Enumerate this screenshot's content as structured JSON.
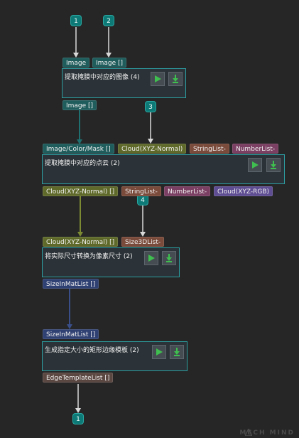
{
  "theme": {
    "accent": "#2c9fa2",
    "badge_color": "#0e7a77",
    "run_icon_color": "#3fbf4f",
    "image_port_color": "#1f5c5c",
    "cloud_port_color": "#5f6a2a",
    "string_list_port_color": "#7a4a3a",
    "number_list_port_color": "#7a3f62",
    "cloud_rgb_port_color": "#5e4d92",
    "size_list_port_color": "#2f4072"
  },
  "inputs": {
    "badge_1": "1",
    "badge_2": "2",
    "badge_3": "3",
    "badge_4": "4"
  },
  "step1": {
    "title": "提取掩膜中对应的图像 (4)",
    "in_port_1": "Image",
    "in_port_2": "Image []",
    "out_port": "Image []"
  },
  "step2": {
    "title": "提取掩膜中对应的点云 (2)",
    "in_port_1": "Image/Color/Mask []",
    "in_port_2": "Cloud(XYZ-Normal)",
    "in_port_3": "StringList-",
    "in_port_4": "NumberList-",
    "out_port_1": "Cloud(XYZ-Normal) []",
    "out_port_2": "StringList-",
    "out_port_3": "NumberList-",
    "out_port_4": "Cloud(XYZ-RGB)"
  },
  "step3": {
    "title": "将实际尺寸转换为像素尺寸 (2)",
    "in_port_1": "Cloud(XYZ-Normal) []",
    "in_port_2": "Size3DList-",
    "out_port": "SizeInMatList []"
  },
  "step4": {
    "title": "生成指定大小的矩形边缘模板 (2)",
    "in_port": "SizeInMatList []",
    "out_port": "EdgeTemplateList []"
  },
  "output": {
    "badge_1": "1"
  },
  "watermark": "MECH MIND",
  "icons": [
    "run-icon",
    "debug-output-icon",
    "mech-mind-logo-icon"
  ]
}
